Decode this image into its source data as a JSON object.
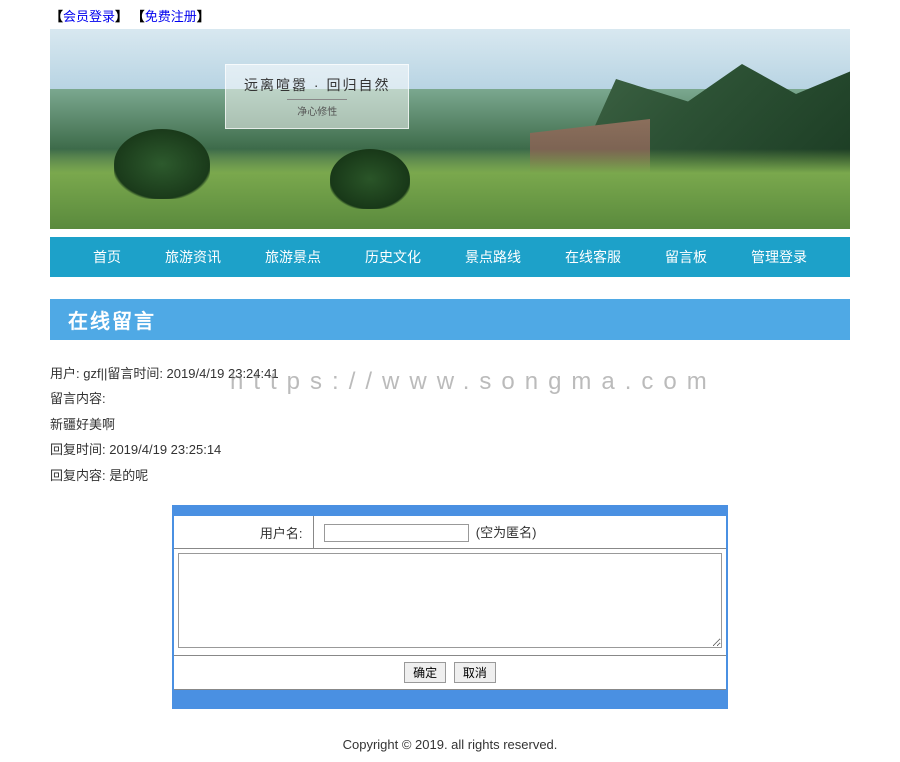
{
  "top_links": {
    "login": "会员登录",
    "register": "免费注册"
  },
  "banner": {
    "title": "远离喧嚣 · 回归自然",
    "subtitle": "净心修性"
  },
  "nav": [
    "首页",
    "旅游资讯",
    "旅游景点",
    "历史文化",
    "景点路线",
    "在线客服",
    "留言板",
    "管理登录"
  ],
  "section_title": "在线留言",
  "watermark": "https://www.songma.com",
  "message": {
    "user_line": "用户: gzf||留言时间: 2019/4/19 23:24:41",
    "content_label": "留言内容:",
    "content_text": "新疆好美啊",
    "reply_time_line": "回复时间:   2019/4/19 23:25:14",
    "reply_content_line": "回复内容:   是的呢"
  },
  "form": {
    "username_label": "用户名:",
    "anonymous_hint": "(空为匿名)",
    "submit_label": "确定",
    "cancel_label": "取消"
  },
  "copyright": "Copyright © 2019. all rights reserved."
}
